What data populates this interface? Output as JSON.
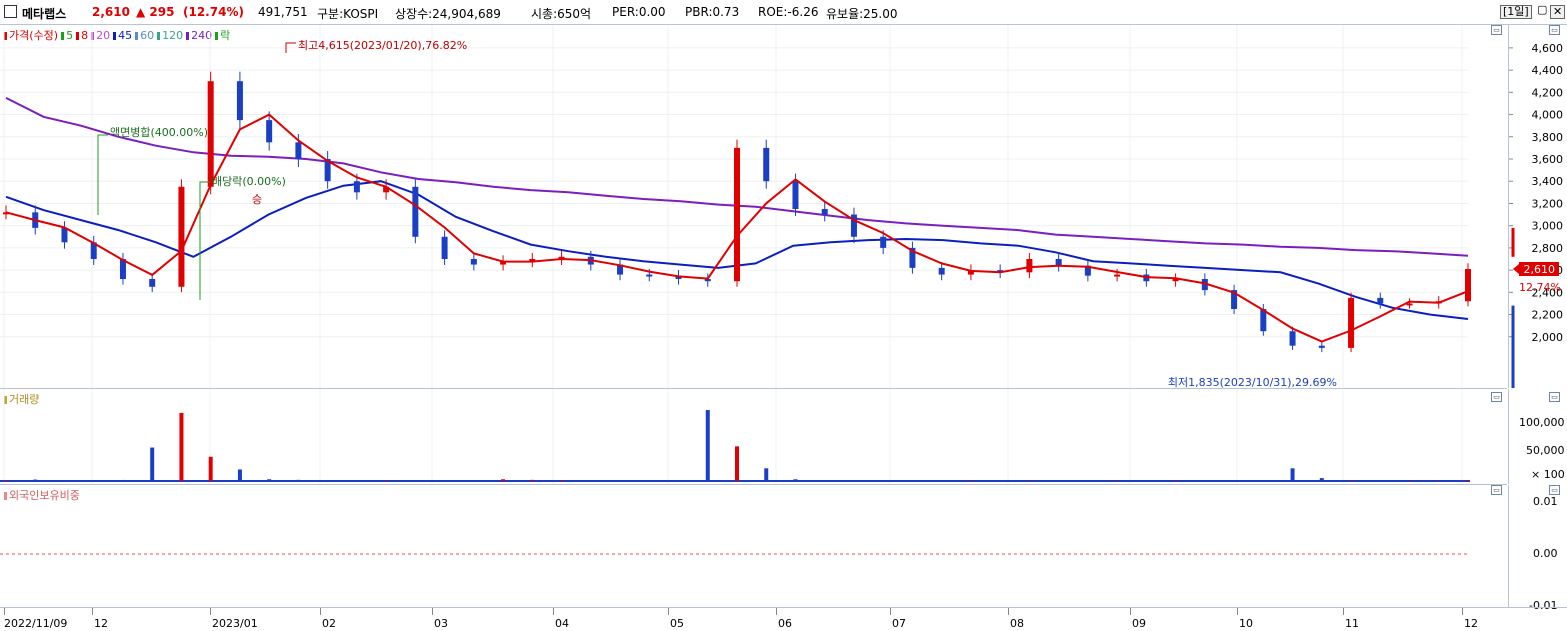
{
  "header": {
    "name": "메타랩스",
    "price": "2,610",
    "change": "▲ 295",
    "change_pct": "(12.74%)",
    "volume": "491,751",
    "market": "구분:KOSPI",
    "listed": "상장수:24,904,689",
    "mcap": "시총:650억",
    "per": "PER:0.00",
    "pbr": "PBR:0.73",
    "roe": "ROE:-6.26",
    "float": "유보율:25.00",
    "period": "[1일]",
    "close_btn": "✕"
  },
  "colors": {
    "up": "#e00000",
    "down": "#1b3fc4",
    "ma5": "#1e9e1e",
    "ma8": "#e00000",
    "ma20": "#cc44cc",
    "ma45": "#0b1ec0",
    "ma60": "#5a8fc0",
    "ma120": "#3aa48a",
    "ma240": "#7a1ec0"
  },
  "legend": [
    {
      "text": "가격(수정)",
      "color": "#e00000"
    },
    {
      "text": "5",
      "color": "#1e9e1e"
    },
    {
      "text": "8",
      "color": "#e00000"
    },
    {
      "text": "20",
      "color": "#cc44cc"
    },
    {
      "text": "45",
      "color": "#0b1ec0"
    },
    {
      "text": "60",
      "color": "#5a8fc0"
    },
    {
      "text": "120",
      "color": "#3aa48a"
    },
    {
      "text": "240",
      "color": "#7a1ec0"
    },
    {
      "text": "락",
      "color": "#1e9e1e"
    }
  ],
  "annotations": {
    "high": "최고4,615(2023/01/20),76.82%",
    "low": "최저1,835(2023/10/31),29.69%",
    "split": "액면병합(400.00%)",
    "dividend": "배당락(0.00%)",
    "right_up": "승"
  },
  "price_tag": {
    "price": "2,610",
    "pct": "12.74%"
  },
  "volume_panel": {
    "label": "거래량",
    "ticks": [
      "100,000",
      "50,000",
      "× 100"
    ]
  },
  "foreign_panel": {
    "label": "외국인보유비중",
    "ticks": [
      "0.01",
      "0.00",
      "-0.01"
    ]
  },
  "chart_data": {
    "type": "line",
    "y_ticks": [
      "4,600",
      "4,400",
      "4,200",
      "4,000",
      "3,800",
      "3,600",
      "3,400",
      "3,200",
      "3,000",
      "2,800",
      "2,600",
      "2,400",
      "2,200",
      "2,000"
    ],
    "ylim": [
      1800,
      4700
    ],
    "x_ticks": [
      "2022/11/09",
      "12",
      "2023/01",
      "02",
      "03",
      "04",
      "05",
      "06",
      "07",
      "08",
      "09",
      "10",
      "11",
      "12"
    ],
    "price_close": [
      3120,
      2980,
      2850,
      2700,
      2520,
      2450,
      3350,
      4300,
      3950,
      3750,
      3600,
      3400,
      3300,
      3350,
      2900,
      2700,
      2650,
      2680,
      2700,
      2720,
      2650,
      2560,
      2550,
      2520,
      2500,
      3700,
      3400,
      3150,
      3100,
      2900,
      2800,
      2620,
      2560,
      2600,
      2580,
      2700,
      2640,
      2550,
      2560,
      2500,
      2520,
      2420,
      2250,
      2050,
      1920,
      1900,
      2350,
      2300,
      2300,
      2320,
      2610
    ],
    "ma240": [
      4150,
      3980,
      3900,
      3800,
      3720,
      3660,
      3630,
      3620,
      3600,
      3560,
      3480,
      3420,
      3390,
      3350,
      3320,
      3300,
      3270,
      3240,
      3220,
      3190,
      3170,
      3130,
      3090,
      3050,
      3020,
      3000,
      2980,
      2960,
      2920,
      2900,
      2880,
      2860,
      2840,
      2830,
      2810,
      2800,
      2780,
      2770,
      2750,
      2730
    ],
    "ma45": [
      3260,
      3140,
      3050,
      2960,
      2850,
      2720,
      2900,
      3100,
      3250,
      3360,
      3400,
      3280,
      3080,
      2950,
      2830,
      2770,
      2720,
      2680,
      2650,
      2620,
      2660,
      2820,
      2850,
      2870,
      2880,
      2870,
      2840,
      2820,
      2760,
      2680,
      2660,
      2640,
      2620,
      2600,
      2580,
      2480,
      2360,
      2260,
      2200,
      2160
    ],
    "volume": [
      1200,
      2500,
      1500,
      1200,
      1800,
      58000,
      118000,
      42000,
      20000,
      3000,
      2000,
      1500,
      1000,
      800,
      600,
      500,
      700,
      3000,
      2000,
      1500,
      1000,
      800,
      600,
      500,
      123000,
      60000,
      22000,
      3000,
      1200,
      1000,
      900,
      800,
      700,
      800,
      700,
      600,
      500,
      600,
      700,
      800,
      900,
      900,
      1000,
      1200,
      22000,
      5000,
      1000,
      800,
      700,
      600,
      1500
    ],
    "volume_ticks": [
      "100,000",
      "50,000",
      "× 100"
    ]
  }
}
